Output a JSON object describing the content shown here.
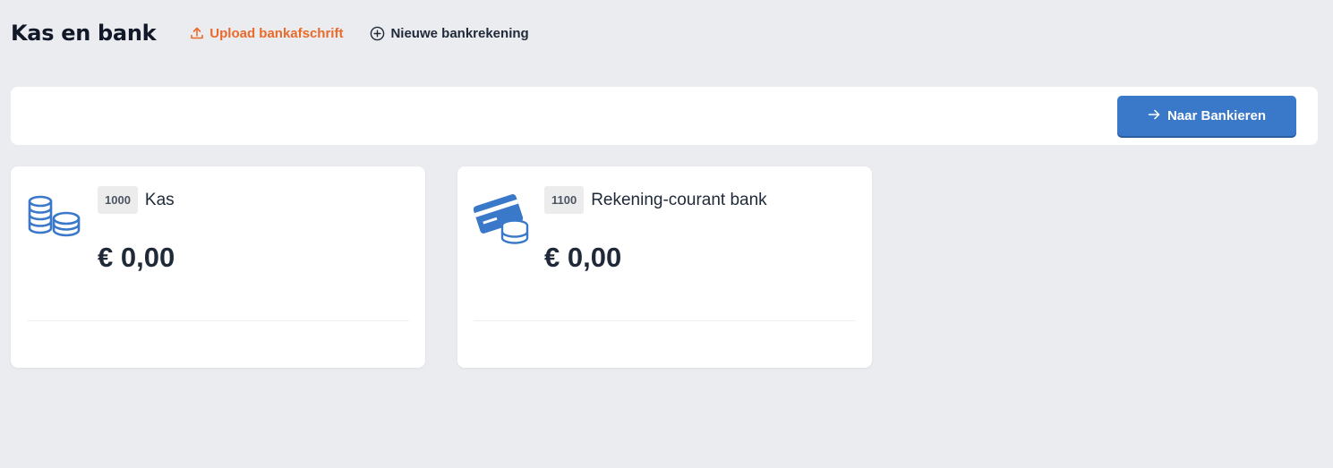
{
  "header": {
    "title": "Kas en bank",
    "upload_label": "Upload bankafschrift",
    "new_account_label": "Nieuwe bankrekening"
  },
  "toolbar": {
    "bank_button_label": "Naar Bankieren"
  },
  "accounts": [
    {
      "number": "1000",
      "name": "Kas",
      "balance": "€ 0,00",
      "icon": "coins-icon"
    },
    {
      "number": "1100",
      "name": "Rekening-courant bank",
      "balance": "€ 0,00",
      "icon": "credit-card-coins-icon"
    }
  ],
  "colors": {
    "accent_orange": "#ea6a2a",
    "primary_blue": "#3a78c9",
    "background": "#ebecf0"
  }
}
